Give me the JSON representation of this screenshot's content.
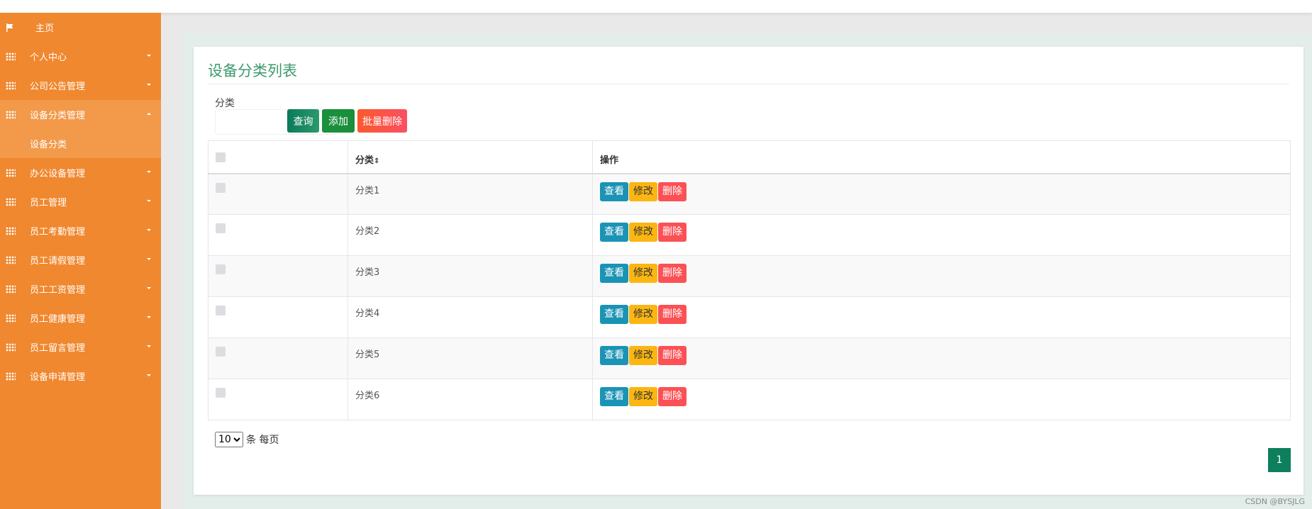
{
  "sidebar": {
    "items": [
      {
        "label": "主页",
        "icon": "flag-icon"
      },
      {
        "label": "个人中心",
        "icon": "grid-icon"
      },
      {
        "label": "公司公告管理",
        "icon": "grid-icon"
      },
      {
        "label": "设备分类管理",
        "icon": "grid-icon",
        "expanded": true
      },
      {
        "label": "设备分类",
        "sub": true
      },
      {
        "label": "办公设备管理",
        "icon": "grid-icon"
      },
      {
        "label": "员工管理",
        "icon": "grid-icon"
      },
      {
        "label": "员工考勤管理",
        "icon": "grid-icon"
      },
      {
        "label": "员工请假管理",
        "icon": "grid-icon"
      },
      {
        "label": "员工工资管理",
        "icon": "grid-icon"
      },
      {
        "label": "员工健康管理",
        "icon": "grid-icon"
      },
      {
        "label": "员工留言管理",
        "icon": "grid-icon"
      },
      {
        "label": "设备申请管理",
        "icon": "grid-icon"
      }
    ]
  },
  "main": {
    "title": "设备分类列表",
    "filter": {
      "label": "分类",
      "value": "",
      "placeholder": ""
    },
    "buttons": {
      "query": "查询",
      "add": "添加",
      "batch_delete": "批量删除"
    },
    "table": {
      "headers": [
        "",
        "分类",
        "操作"
      ],
      "sort_icon": "⇕",
      "rows": [
        "分类1",
        "分类2",
        "分类3",
        "分类4",
        "分类5",
        "分类6"
      ],
      "actions": {
        "view": "查看",
        "edit": "修改",
        "delete": "删除"
      }
    },
    "pagination": {
      "page_size": "10",
      "page_size_options": [
        "10"
      ],
      "per_page_label": "条 每页",
      "current_page": "1"
    }
  },
  "watermark": "CSDN @BYSJLG",
  "colors": {
    "sidebar": "#f0882f",
    "title": "#3d9a6e",
    "view": "#1b93b5",
    "edit": "#fbb612",
    "delete": "#fb5155"
  }
}
